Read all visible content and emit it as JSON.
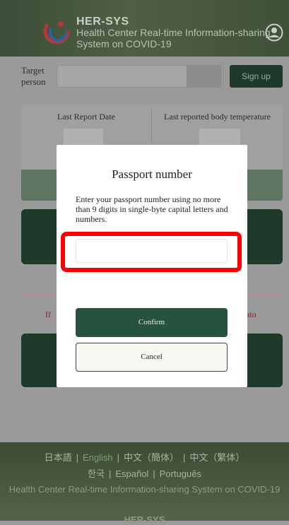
{
  "header": {
    "brand_title": "HER-SYS",
    "brand_subtitle": "Health Center Real-time Information-sharing System on COVID-19",
    "logo_icon": "her-sys-logo-icon",
    "user_icon": "user-account-icon"
  },
  "target": {
    "label": "Target person",
    "signup_label": "Sign up"
  },
  "cards": {
    "last_report_date_label": "Last Report Date",
    "last_temperature_label": "Last reported body temperature"
  },
  "notice": {
    "left_fragment": "If",
    "right_fragment": "ato"
  },
  "modal": {
    "title": "Passport number",
    "description": "Enter your passport number using no more than 9 digits in single-byte capital letters and numbers.",
    "input_value": "",
    "confirm_label": "Confirm",
    "cancel_label": "Cancel",
    "highlight_color": "#ff0000"
  },
  "footer": {
    "languages_row1": [
      "日本語",
      "English",
      "中文（簡体）",
      "中文（繁体）"
    ],
    "languages_row2": [
      "한국",
      "Español",
      "Português"
    ],
    "active_language": "English",
    "description": "Health Center Real-time Information-sharing System on COVID-19",
    "brand": "HER-SYS"
  },
  "colors": {
    "brand_dark_green": "#1e3a2b",
    "confirm_green": "#275240",
    "alert_red": "#8b1f1f"
  }
}
